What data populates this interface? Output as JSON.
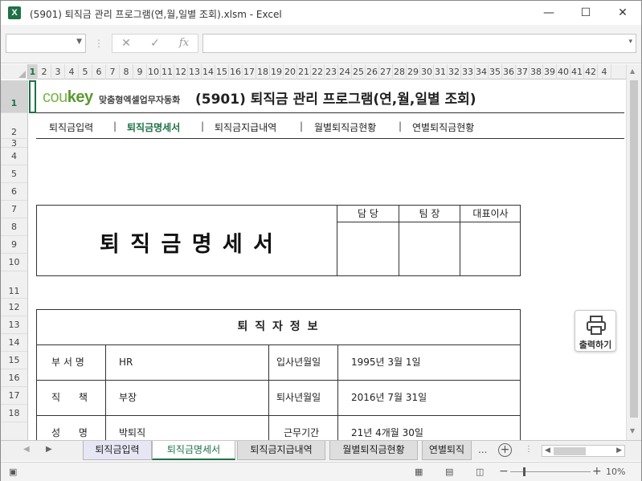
{
  "window": {
    "title": "(5901) 퇴직금 관리 프로그램(연,월,일별 조회).xlsm - Excel",
    "app_icon": "X",
    "min": "—",
    "max": "☐",
    "close": "✕"
  },
  "formula_bar": {
    "cancel_icon": "✕",
    "enter_icon": "✓",
    "fx_icon": "fx"
  },
  "columns": [
    "1",
    "2",
    "3",
    "4",
    "5",
    "6",
    "7",
    "8",
    "9",
    "10",
    "11",
    "12",
    "13",
    "14",
    "15",
    "16",
    "17",
    "18",
    "19",
    "20",
    "21",
    "22",
    "23",
    "24",
    "25",
    "26",
    "27",
    "28",
    "29",
    "30",
    "31",
    "32",
    "33",
    "34",
    "35",
    "36",
    "37",
    "38",
    "39",
    "40",
    "41",
    "42",
    "4"
  ],
  "rows": [
    "1",
    "2",
    "3",
    "4",
    "5",
    "6",
    "7",
    "8",
    "9",
    "10",
    "11",
    "12",
    "13",
    "14",
    "15",
    "16",
    "17",
    "18"
  ],
  "header": {
    "logo_left": "cou",
    "logo_right": "key",
    "logo_sub": "맞춤형엑셀업무자동화",
    "program_title": "(5901) 퇴직금 관리 프로그램(연,월,일별 조회)"
  },
  "nav": {
    "items": [
      "퇴직금입력",
      "퇴직금명세서",
      "퇴직금지급내역",
      "월별퇴직금현황",
      "연별퇴직금현황"
    ],
    "separator": "|"
  },
  "doc": {
    "title": "퇴 직 금  명 세 서",
    "approvals": [
      "담 당",
      "팀 장",
      "대표이사"
    ]
  },
  "info": {
    "title": "퇴 직 자 정 보",
    "rows": [
      {
        "label": "부 서 명",
        "value": "HR",
        "label2": "입사년월일",
        "value2": "1995년 3월 1일"
      },
      {
        "label": "직      책",
        "value": "부장",
        "label2": "퇴사년월일",
        "value2": "2016년 7월 31일"
      },
      {
        "label": "성      명",
        "value": "박퇴직",
        "label2": "근무기간",
        "value2": "21년 4개월 30일"
      }
    ]
  },
  "print_button": {
    "label": "출력하기"
  },
  "tabs": [
    "퇴직금입력",
    "퇴직금명세서",
    "퇴직금지급내역",
    "월별퇴직금현황",
    "연별퇴직"
  ],
  "tabs_more": "...",
  "zoom": "10%",
  "colors": {
    "excel_green": "#1e7145",
    "logo_green": "#7ab648",
    "active_tab": "#1e7145"
  }
}
